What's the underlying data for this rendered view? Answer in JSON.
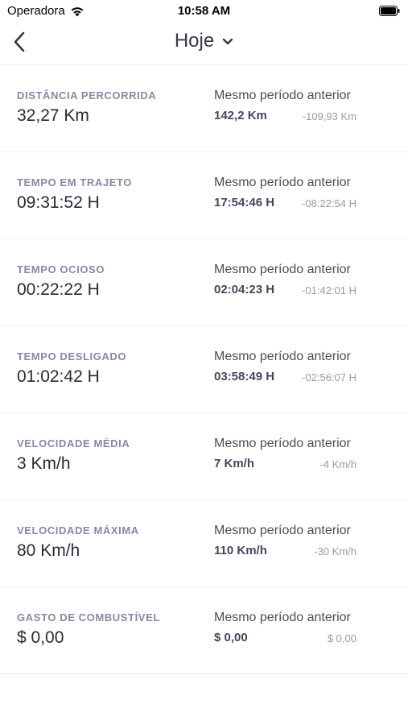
{
  "status_bar": {
    "carrier": "Operadora",
    "time": "10:58 AM"
  },
  "nav": {
    "title": "Hoje"
  },
  "rows": [
    {
      "label": "DISTÂNCIA PERCORRIDA",
      "value": "32,27 Km",
      "compare_title": "Mesmo período anterior",
      "compare_value": "142,2 Km",
      "diff": "-109,93 Km"
    },
    {
      "label": "TEMPO EM TRAJETO",
      "value": "09:31:52 H",
      "compare_title": "Mesmo período anterior",
      "compare_value": "17:54:46 H",
      "diff": "-08:22:54 H"
    },
    {
      "label": "TEMPO OCIOSO",
      "value": "00:22:22 H",
      "compare_title": "Mesmo período anterior",
      "compare_value": "02:04:23 H",
      "diff": "-01:42:01 H"
    },
    {
      "label": "TEMPO DESLIGADO",
      "value": "01:02:42 H",
      "compare_title": "Mesmo período anterior",
      "compare_value": "03:58:49 H",
      "diff": "-02:56:07 H"
    },
    {
      "label": "VELOCIDADE MÉDIA",
      "value": "3 Km/h",
      "compare_title": "Mesmo período anterior",
      "compare_value": "7 Km/h",
      "diff": "-4 Km/h"
    },
    {
      "label": "VELOCIDADE MÁXIMA",
      "value": "80 Km/h",
      "compare_title": "Mesmo período anterior",
      "compare_value": "110 Km/h",
      "diff": "-30 Km/h"
    },
    {
      "label": "GASTO DE COMBUSTÍVEL",
      "value": "$ 0,00",
      "compare_title": "Mesmo período anterior",
      "compare_value": "$ 0,00",
      "diff": "$ 0,00"
    }
  ],
  "icons": {
    "back": "chevron-left-icon",
    "title_dropdown": "chevron-down-icon",
    "wifi": "wifi-icon",
    "battery": "battery-icon"
  },
  "colors": {
    "label": "#8c86a3",
    "value": "#2b2838",
    "compare_value": "#48445c",
    "diff": "#9c98ac"
  }
}
